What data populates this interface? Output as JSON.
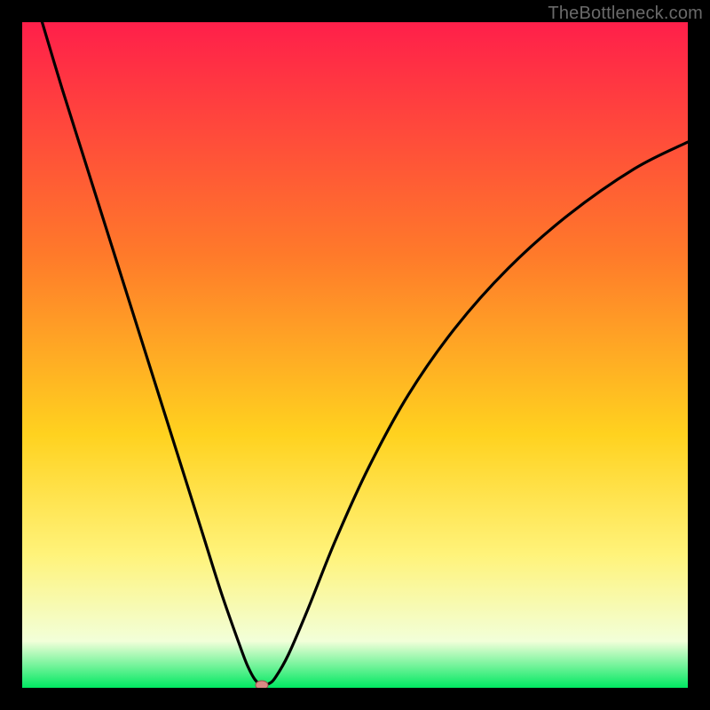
{
  "watermark": "TheBottleneck.com",
  "colors": {
    "frame": "#000000",
    "gradient_top": "#ff1f4a",
    "gradient_mid1": "#ff7a2a",
    "gradient_mid2": "#ffd21f",
    "gradient_mid3": "#fff37a",
    "gradient_bottom_pale": "#f2ffd9",
    "gradient_bottom": "#00e861",
    "curve": "#000000",
    "marker_fill": "#d98a84",
    "marker_stroke": "#9a534d"
  },
  "chart_data": {
    "type": "line",
    "title": "",
    "xlabel": "",
    "ylabel": "",
    "xlim": [
      0,
      100
    ],
    "ylim": [
      0,
      100
    ],
    "series": [
      {
        "name": "bottleneck-curve",
        "x": [
          3,
          6,
          9,
          12,
          15,
          18,
          21,
          24,
          27,
          30,
          33,
          34,
          35,
          36,
          37,
          38,
          40,
          43,
          47,
          52,
          58,
          65,
          73,
          82,
          92,
          100
        ],
        "y": [
          100,
          90,
          80.5,
          71,
          61.5,
          52,
          42.5,
          33,
          23.5,
          14,
          5.5,
          3,
          1.2,
          0.4,
          0.6,
          1.5,
          5,
          12,
          22,
          33,
          44,
          54,
          63,
          71,
          78,
          82
        ]
      }
    ],
    "marker": {
      "x": 36,
      "y": 0.4
    }
  }
}
